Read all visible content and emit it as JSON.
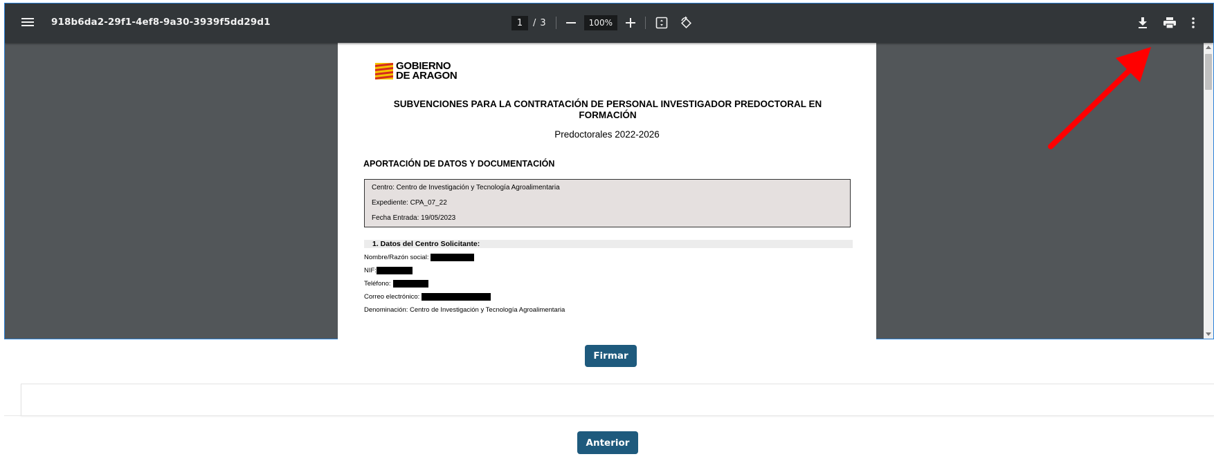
{
  "toolbar": {
    "menu_icon": "hamburger-menu-icon",
    "title": "918b6da2-29f1-4ef8-9a30-3939f5dd29d1",
    "page_current": "1",
    "page_separator": "/",
    "page_total": "3",
    "zoom_out_icon": "minus-icon",
    "zoom_value": "100%",
    "zoom_in_icon": "plus-icon",
    "fit_icon": "fit-page-icon",
    "rotate_icon": "rotate-icon",
    "download_icon": "download-icon",
    "print_icon": "print-icon",
    "more_icon": "more-vert-icon"
  },
  "document": {
    "logo_line1": "GOBIERNO",
    "logo_line2": "DE ARAGON",
    "title": "SUBVENCIONES PARA LA CONTRATACIÓN DE PERSONAL INVESTIGADOR PREDOCTORAL EN FORMACIÓN",
    "subtitle": "Predoctorales 2022-2026",
    "section_heading": "APORTACIÓN DE DATOS Y DOCUMENTACIÓN",
    "info": {
      "centro": "Centro: Centro de Investigación y Tecnología Agroalimentaria",
      "expediente": "Expediente: CPA_07_22",
      "fecha": "Fecha Entrada: 19/05/2023"
    },
    "subsection_heading": "1. Datos del Centro Solicitante:",
    "fields": {
      "nombre": "Nombre/Razón social:",
      "nif": "NIF:",
      "telefono": "Teléfono:",
      "correo": "Correo electrónico:",
      "denominacion": "Denominación: Centro de Investigación y Tecnología Agroalimentaria"
    }
  },
  "colors": {
    "toolbar_bg": "#323639",
    "viewer_bg": "#525659",
    "button_bg": "#1e5a7d",
    "arrow": "#ff0000",
    "flag_yellow": "#f5c400",
    "flag_red": "#d52b1e"
  },
  "actions": {
    "firmar_label": "Firmar",
    "anterior_label": "Anterior"
  }
}
